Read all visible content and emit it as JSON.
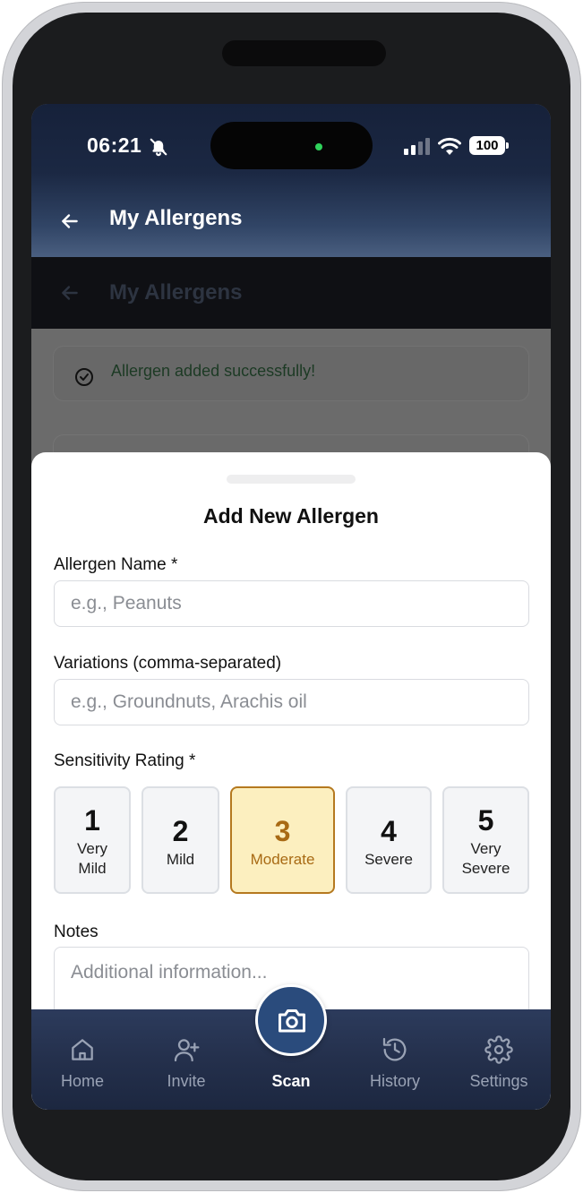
{
  "status_bar": {
    "time": "06:21",
    "battery": "100"
  },
  "header": {
    "title": "My Allergens"
  },
  "background": {
    "title": "My Allergens",
    "toast": "Allergen added successfully!"
  },
  "sheet": {
    "title": "Add New Allergen",
    "name_label": "Allergen Name *",
    "name_placeholder": "e.g., Peanuts",
    "variations_label": "Variations (comma-separated)",
    "variations_placeholder": "e.g., Groundnuts, Arachis oil",
    "rating_label": "Sensitivity Rating *",
    "ratings": [
      {
        "num": "1",
        "label": "Very Mild",
        "selected": false
      },
      {
        "num": "2",
        "label": "Mild",
        "selected": false
      },
      {
        "num": "3",
        "label": "Moderate",
        "selected": true
      },
      {
        "num": "4",
        "label": "Severe",
        "selected": false
      },
      {
        "num": "5",
        "label": "Very Severe",
        "selected": false
      }
    ],
    "notes_label": "Notes",
    "notes_placeholder": "Additional information..."
  },
  "nav": {
    "items": [
      {
        "label": "Home",
        "icon": "home-icon"
      },
      {
        "label": "Invite",
        "icon": "user-plus-icon"
      },
      {
        "label": "Scan",
        "icon": "camera-icon",
        "active": true
      },
      {
        "label": "History",
        "icon": "history-icon"
      },
      {
        "label": "Settings",
        "icon": "gear-icon"
      }
    ]
  },
  "colors": {
    "header_dark": "#16213a",
    "nav_bg": "#24304c",
    "scan_button": "#2a4b7c",
    "selected_fill": "#fcefbf",
    "selected_border": "#b5791f",
    "selected_text": "#a86a14"
  }
}
